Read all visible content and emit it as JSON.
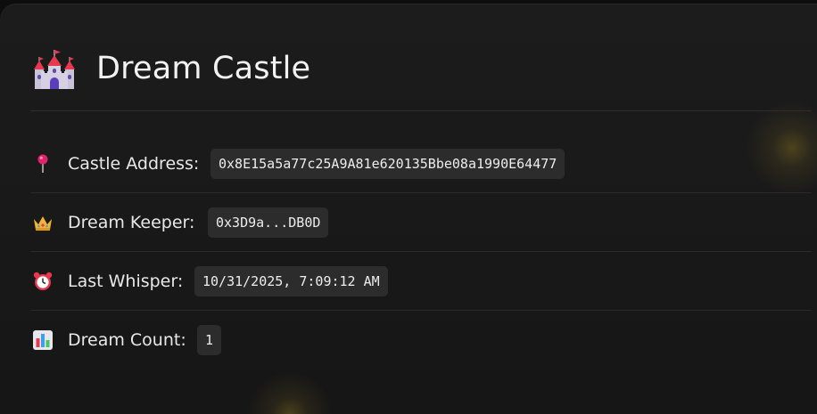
{
  "header": {
    "icon": "castle-icon",
    "title": "Dream Castle"
  },
  "rows": [
    {
      "icon": "pushpin-icon",
      "label": "Castle Address:",
      "value": "0x8E15a5a77c25A9A81e620135Bbe08a1990E64477"
    },
    {
      "icon": "crown-icon",
      "label": "Dream Keeper:",
      "value": "0x3D9a...DB0D"
    },
    {
      "icon": "alarm-clock-icon",
      "label": "Last Whisper:",
      "value": "10/31/2025, 7:09:12 AM"
    },
    {
      "icon": "bar-chart-icon",
      "label": "Dream Count:",
      "value": "1"
    }
  ],
  "colors": {
    "background": "#1a1a1a",
    "pill": "#2c2c2c",
    "text": "#e8e8e8",
    "glow": "#c4a028"
  }
}
